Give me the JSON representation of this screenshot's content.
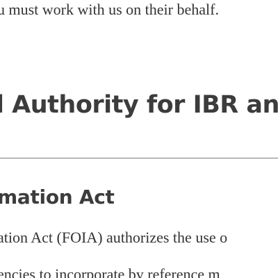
{
  "document": {
    "intro_tail": "u must work with us on their behalf.",
    "section_heading": "l Authority for IBR an",
    "subsection_heading": "mation Act",
    "para_line_1": "ation Act (FOIA) authorizes the use o",
    "para_line_2": "encies to incorporate by reference m"
  }
}
